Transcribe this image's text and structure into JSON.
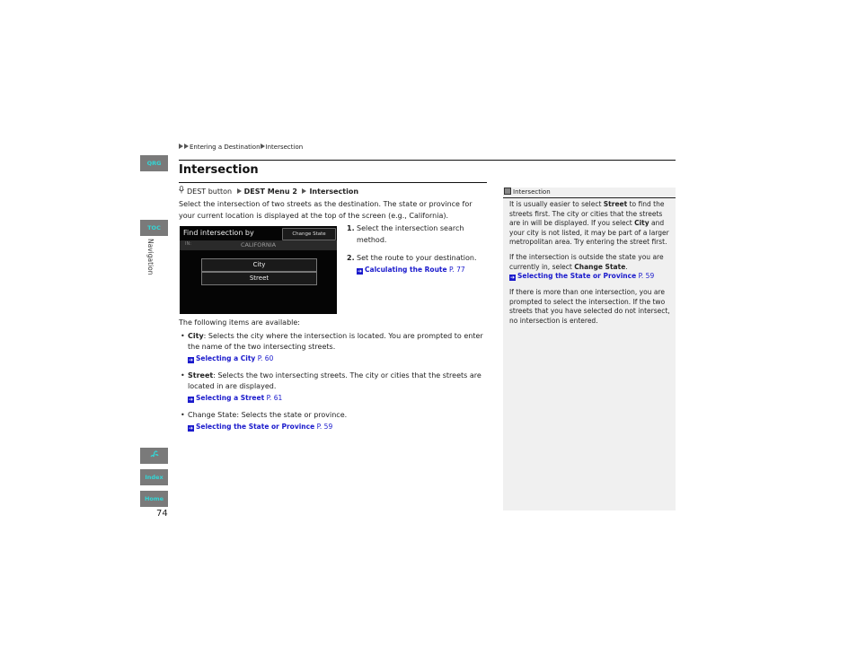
{
  "side_tabs": {
    "qrg": "QRG",
    "toc": "TOC",
    "section_label": "Navigation",
    "voice_icon": "voice-command-icon",
    "index": "Index",
    "home": "Home",
    "page_number": "74"
  },
  "breadcrumb": {
    "items": [
      "Entering a Destination",
      "Intersection"
    ]
  },
  "page": {
    "title": "Intersection",
    "path": {
      "icon": "microphone-icon",
      "start": "DEST button",
      "step1": "DEST Menu 2",
      "step2": "Intersection"
    },
    "intro": "Select the intersection of two streets as the destination. The state or province for your current location is displayed at the top of the screen (e.g., California)."
  },
  "screen": {
    "title": "Find intersection by",
    "change_state_button": "Change State",
    "bar_icon": "IN:",
    "current_state": "CALIFORNIA",
    "options": [
      "City",
      "Street"
    ]
  },
  "steps": [
    {
      "number": "1.",
      "text": "Select the intersection search method."
    },
    {
      "number": "2.",
      "text": "Set the route to your destination.",
      "link": {
        "label": "Calculating the Route",
        "page": "P. 77"
      }
    }
  ],
  "available": {
    "heading": "The following items are available:",
    "items": [
      {
        "term": "City",
        "desc": ": Selects the city where the intersection is located. You are prompted to enter the name of the two intersecting streets.",
        "link": {
          "label": "Selecting a City",
          "page": "P. 60"
        }
      },
      {
        "term": "Street",
        "desc": ": Selects the two intersecting streets. The city or cities that the streets are located in are displayed.",
        "link": {
          "label": "Selecting a Street",
          "page": "P. 61"
        }
      },
      {
        "term": "Change State",
        "desc": ": Selects the state or province.",
        "link": {
          "label": "Selecting the State or Province",
          "page": "P. 59"
        }
      }
    ]
  },
  "note": {
    "heading": "Intersection",
    "p1_a": "It is usually easier to select ",
    "p1_b": "Street",
    "p1_c": " to find the streets first. The city or cities that the streets are in will be displayed. If you select ",
    "p1_d": "City",
    "p1_e": " and your city is not listed, it may be part of a larger metropolitan area. Try entering the street first.",
    "p2_a": "If the intersection is outside the state you are currently in, select ",
    "p2_b": "Change State",
    "p2_c": ".",
    "p2_link": {
      "label": "Selecting the State or Province",
      "page": "P. 59"
    },
    "p3": "If there is more than one intersection, you are prompted to select the intersection. If the two streets that you have selected do not intersect, no intersection is entered."
  },
  "colors": {
    "link": "#1a1acc",
    "tab_bg": "#7a7a7a",
    "tab_text": "#33d6d6",
    "note_bg": "#f0f0f0"
  }
}
